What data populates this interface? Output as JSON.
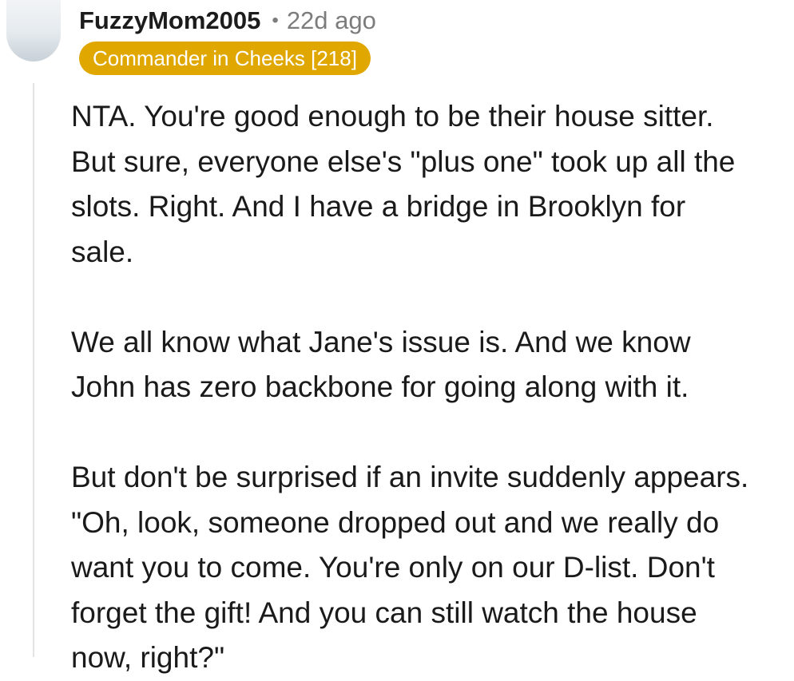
{
  "comment": {
    "author": "FuzzyMom2005",
    "separator": "•",
    "timestamp": "22d ago",
    "flair": "Commander in Cheeks [218]",
    "flair_color": "#e0a700",
    "paragraphs": [
      "NTA.  You're good enough to be their house sitter.\nBut sure, everyone else's \"plus one\" took up all the\nslots. Right. And I have a bridge in Brooklyn for\nsale.",
      "We all know what Jane's issue is. And we know\nJohn has zero backbone for going along with it.",
      "But don't be surprised if an invite suddenly appears.\n\"Oh, look, someone dropped out and we really do\nwant you to come. You're only on our D-list. Don't\nforget the gift!  And you can still watch the house\nnow, right?\""
    ]
  }
}
